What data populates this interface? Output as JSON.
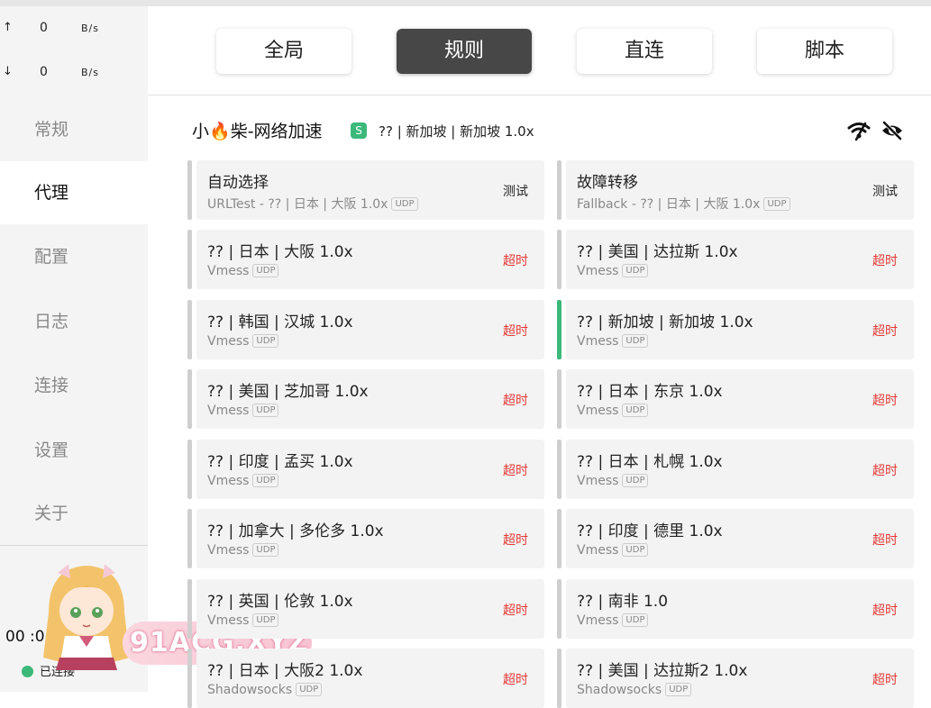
{
  "traffic": {
    "up": {
      "arrow": "↑",
      "value": "0",
      "unit": "B/s"
    },
    "down": {
      "arrow": "↓",
      "value": "0",
      "unit": "B/s"
    }
  },
  "nav": [
    {
      "label": "常规"
    },
    {
      "label": "代理"
    },
    {
      "label": "配置"
    },
    {
      "label": "日志"
    },
    {
      "label": "连接"
    },
    {
      "label": "设置"
    },
    {
      "label": "关于"
    }
  ],
  "time": "00 :0",
  "connection_status": "已连接",
  "watermark": "91ACG.XYZ",
  "modes": [
    "全局",
    "规则",
    "直连",
    "脚本"
  ],
  "group": {
    "name_prefix": "小",
    "fire": "🔥",
    "name_suffix": "柴-网络加速",
    "badge": "S",
    "selected": "?? | 新加坡 | 新加坡 1.0x"
  },
  "colors": {
    "accent": "#3bb87a",
    "timeout": "#e53935",
    "active_mode": "#474747"
  },
  "proxies_left": [
    {
      "name": "自动选择",
      "type": "URLTest - ?? | 日本 | 大阪 1.0x",
      "udp": "UDP",
      "status": "测试"
    },
    {
      "name": "?? | 日本 | 大阪 1.0x",
      "type": "Vmess",
      "udp": "UDP",
      "status": "超时"
    },
    {
      "name": "?? | 韩国 | 汉城 1.0x",
      "type": "Vmess",
      "udp": "UDP",
      "status": "超时"
    },
    {
      "name": "?? | 美国 | 芝加哥 1.0x",
      "type": "Vmess",
      "udp": "UDP",
      "status": "超时"
    },
    {
      "name": "?? | 印度 | 孟买 1.0x",
      "type": "Vmess",
      "udp": "UDP",
      "status": "超时"
    },
    {
      "name": "?? | 加拿大 | 多伦多 1.0x",
      "type": "Vmess",
      "udp": "UDP",
      "status": "超时"
    },
    {
      "name": "?? | 英国 | 伦敦 1.0x",
      "type": "Vmess",
      "udp": "UDP",
      "status": "超时"
    },
    {
      "name": "?? | 日本 | 大阪2 1.0x",
      "type": "Shadowsocks",
      "udp": "UDP",
      "status": "超时"
    }
  ],
  "proxies_right": [
    {
      "name": "故障转移",
      "type": "Fallback - ?? | 日本 | 大阪 1.0x",
      "udp": "UDP",
      "status": "测试"
    },
    {
      "name": "?? | 美国 | 达拉斯 1.0x",
      "type": "Vmess",
      "udp": "UDP",
      "status": "超时"
    },
    {
      "name": "?? | 新加坡 | 新加坡 1.0x",
      "type": "Vmess",
      "udp": "UDP",
      "status": "超时"
    },
    {
      "name": "?? | 日本 | 东京 1.0x",
      "type": "Vmess",
      "udp": "UDP",
      "status": "超时"
    },
    {
      "name": "?? | 日本 | 札幌 1.0x",
      "type": "Vmess",
      "udp": "UDP",
      "status": "超时"
    },
    {
      "name": "?? | 印度 | 德里 1.0x",
      "type": "Vmess",
      "udp": "UDP",
      "status": "超时"
    },
    {
      "name": "?? | 南非 1.0",
      "type": "Vmess",
      "udp": "UDP",
      "status": "超时"
    },
    {
      "name": "?? | 美国 | 达拉斯2 1.0x",
      "type": "Shadowsocks",
      "udp": "UDP",
      "status": "超时"
    }
  ]
}
